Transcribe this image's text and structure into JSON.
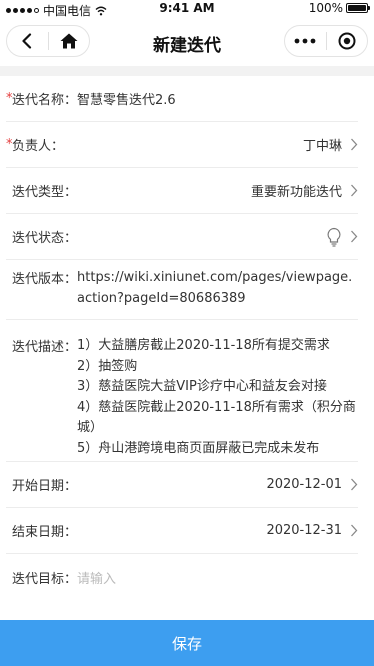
{
  "status_bar": {
    "carrier": "中国电信",
    "time": "9:41 AM",
    "battery": "100%"
  },
  "nav": {
    "title": "新建迭代",
    "back_icon": "chevron-left-icon",
    "home_icon": "home-icon",
    "more_icon": "more-dots-icon",
    "close_icon": "target-circle-icon"
  },
  "form": {
    "name": {
      "label": "迭代名称：",
      "value": "智慧零售迭代2.6",
      "required": "*"
    },
    "owner": {
      "label": "负责人：",
      "value": "丁中琳",
      "required": "*"
    },
    "type": {
      "label": "迭代类型：",
      "value": "重要新功能迭代"
    },
    "status": {
      "label": "迭代状态：",
      "icon": "lightbulb-icon"
    },
    "version": {
      "label": "迭代版本：",
      "value": "https://wiki.xiniunet.com/pages/viewpage.action?pageId=80686389"
    },
    "description": {
      "label": "迭代描述：",
      "lines": [
        "1）大益膳房截止2020-11-18所有提交需求",
        "2）抽签购",
        "3）慈益医院大益VIP诊疗中心和益友会对接",
        "4）慈益医院截止2020-11-18所有需求（积分商城）",
        "5）舟山港跨境电商页面屏蔽已完成未发布"
      ]
    },
    "start_date": {
      "label": "开始日期：",
      "value": "2020-12-01"
    },
    "end_date": {
      "label": "结束日期：",
      "value": "2020-12-31"
    },
    "goal": {
      "label": "迭代目标：",
      "placeholder": "请输入"
    }
  },
  "save_button": {
    "label": "保存"
  },
  "colors": {
    "accent": "#3d9ef0",
    "required": "#e43d3d"
  }
}
